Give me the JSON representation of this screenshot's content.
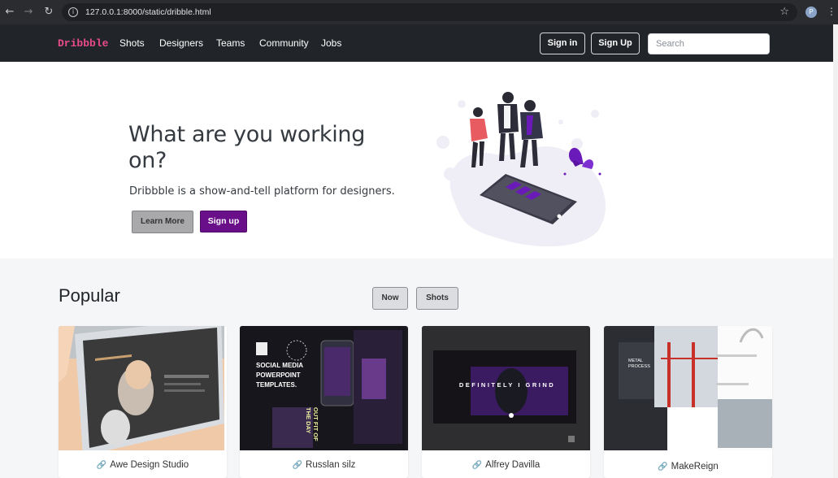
{
  "browser": {
    "url": "127.0.0.1:8000/static/dribble.html",
    "profile_initial": "P"
  },
  "navbar": {
    "brand": "Dribbble",
    "links": [
      "Shots",
      "Designers",
      "Teams",
      "Community",
      "Jobs"
    ],
    "signin_label": "Sign in",
    "signup_label": "Sign Up",
    "search_placeholder": "Search"
  },
  "hero": {
    "title": "What are you working on?",
    "subtitle": "Dribbble is a show-and-tell platform for designers.",
    "learn_more_label": "Learn More",
    "signup_label": "Sign up"
  },
  "popular": {
    "title": "Popular",
    "filters": [
      "Now",
      "Shots"
    ],
    "cards": [
      {
        "author": "Awe Design Studio"
      },
      {
        "author": "Russlan silz",
        "thumb_text": [
          "SOCIAL MEDIA",
          "POWERPOINT",
          "TEMPLATES.",
          "OUT FIT OF THE DAY"
        ]
      },
      {
        "author": "Alfrey Davilla",
        "thumb_text": [
          "DEFINITELY I GRIND"
        ]
      },
      {
        "author": "MakeReign",
        "thumb_text": [
          "METAL PROCESS"
        ]
      }
    ]
  },
  "colors": {
    "brand": "#ea4c89",
    "navbar_bg": "#212529",
    "signup_purple": "#6a0f8a"
  }
}
